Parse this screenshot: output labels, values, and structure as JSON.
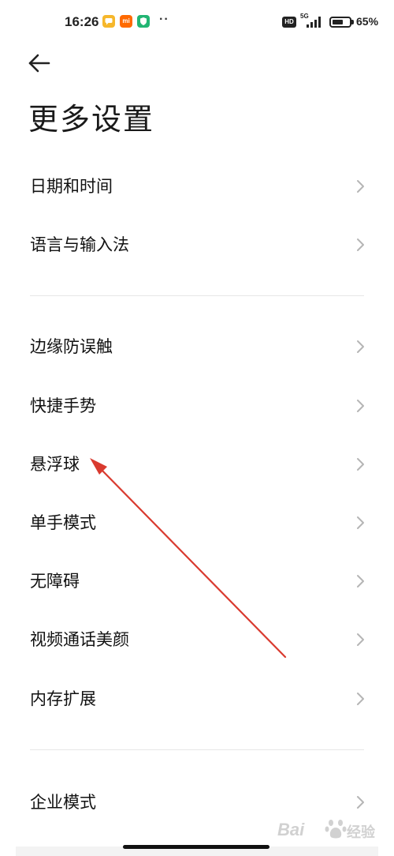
{
  "status_bar": {
    "time": "16:26",
    "notification_icons": [
      "message-icon",
      "mi-app-icon",
      "security-shield-icon"
    ],
    "notif_glyph_2": "mi",
    "more_indicator": "··",
    "hd_label": "HD",
    "network_label": "5G",
    "battery_percent": 65,
    "battery_text": "65%"
  },
  "header": {
    "back_icon": "back-arrow-icon",
    "title": "更多设置"
  },
  "groups": [
    {
      "items": [
        {
          "label": "日期和时间"
        },
        {
          "label": "语言与输入法"
        }
      ]
    },
    {
      "items": [
        {
          "label": "边缘防误触"
        },
        {
          "label": "快捷手势"
        },
        {
          "label": "悬浮球"
        },
        {
          "label": "单手模式"
        },
        {
          "label": "无障碍"
        },
        {
          "label": "视频通话美颜"
        },
        {
          "label": "内存扩展"
        }
      ]
    },
    {
      "items": [
        {
          "label": "企业模式"
        }
      ]
    }
  ],
  "annotation": {
    "color": "#d93a2f",
    "points_to": "悬浮球"
  },
  "watermark": {
    "text_1": "Bai",
    "text_2": "经验"
  },
  "colors": {
    "background": "#ffffff",
    "text": "#111111",
    "chevron": "#b5b5b5",
    "divider": "#e7e7e7"
  }
}
